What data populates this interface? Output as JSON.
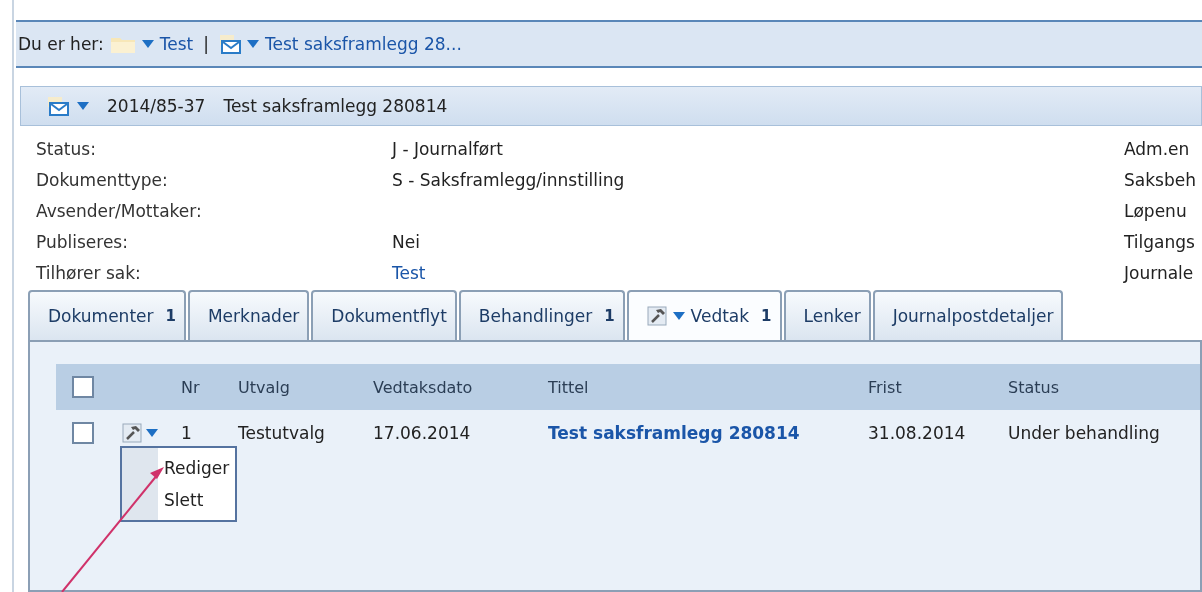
{
  "breadcrumb": {
    "label": "Du er her:",
    "items": [
      {
        "kind": "folder",
        "text": "Test"
      },
      {
        "kind": "document",
        "text": "Test saksframlegg 28..."
      }
    ],
    "separator": "|"
  },
  "header": {
    "number": "2014/85-37",
    "title": "Test saksframlegg 280814"
  },
  "fields": [
    {
      "label": "Status:",
      "value": "J - Journalført",
      "link": false
    },
    {
      "label": "Dokumenttype:",
      "value": "S - Saksframlegg/innstilling",
      "link": false
    },
    {
      "label": "Avsender/Mottaker:"
    },
    {
      "label": "Publiseres:",
      "value": "Nei",
      "link": false
    },
    {
      "label": "Tilhører sak:",
      "value": "Test",
      "link": true
    }
  ],
  "right_labels": [
    "Adm.en",
    "Saksbeh",
    "Løpenu",
    "Tilgangs",
    "Journale"
  ],
  "tabs": [
    {
      "label": "Dokumenter",
      "count": "1",
      "selected": false,
      "has_menu": false
    },
    {
      "label": "Merknader",
      "selected": false,
      "has_menu": false
    },
    {
      "label": "Dokumentflyt",
      "selected": false,
      "has_menu": false
    },
    {
      "label": "Behandlinger",
      "count": "1",
      "selected": false,
      "has_menu": false
    },
    {
      "label": "Vedtak",
      "count": "1",
      "selected": true,
      "has_menu": true
    },
    {
      "label": "Lenker",
      "selected": false,
      "has_menu": false
    },
    {
      "label": "Journalpostdetaljer",
      "selected": false,
      "has_menu": false
    }
  ],
  "table": {
    "header_checked": false,
    "columns": [
      "Nr",
      "Utvalg",
      "Vedtaksdato",
      "Tittel",
      "Frist",
      "Status"
    ],
    "rows": [
      {
        "checked": false,
        "nr": "1",
        "utvalg": "Testutvalg",
        "vedtaksdato": "17.06.2014",
        "tittel": "Test saksframlegg 280814",
        "frist": "31.08.2014",
        "status": "Under behandling"
      }
    ]
  },
  "row_menu": {
    "items": [
      "Rediger",
      "Slett"
    ]
  }
}
